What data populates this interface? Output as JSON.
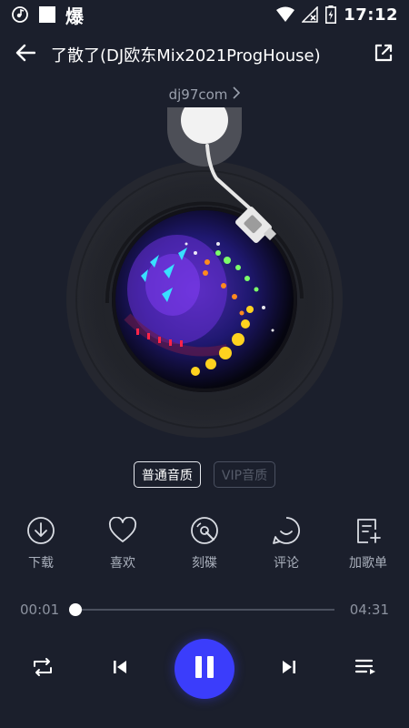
{
  "status_bar": {
    "time": "17:12",
    "left_text": "爆",
    "icons": [
      "music-notification-icon",
      "app-square-icon",
      "wifi-icon",
      "no-signal-icon",
      "charging-battery-icon"
    ]
  },
  "header": {
    "title": "了散了(DJ欧东Mix2021ProgHouse)",
    "icons": [
      "back-arrow-icon",
      "share-icon"
    ]
  },
  "artist": {
    "name": "dj97com",
    "icon": "chevron-right-icon"
  },
  "quality": {
    "normal_label": "普通音质",
    "vip_label": "VIP音质",
    "selected": "普通音质"
  },
  "actions": [
    {
      "label": "下载",
      "icon": "download-icon"
    },
    {
      "label": "喜欢",
      "icon": "heart-icon"
    },
    {
      "label": "刻碟",
      "icon": "disc-icon"
    },
    {
      "label": "评论",
      "icon": "comment-icon"
    },
    {
      "label": "加歌单",
      "icon": "add-to-playlist-icon"
    }
  ],
  "player": {
    "current_time": "00:01",
    "total_time": "04:31",
    "progress": 0.004,
    "state": "playing"
  },
  "controls": {
    "icons": [
      "repeat-icon",
      "previous-icon",
      "pause-icon",
      "next-icon",
      "playlist-icon"
    ]
  },
  "colors": {
    "background": "#1b1f2c",
    "accent": "#3b3dfb",
    "text_secondary": "#aab0bc"
  }
}
